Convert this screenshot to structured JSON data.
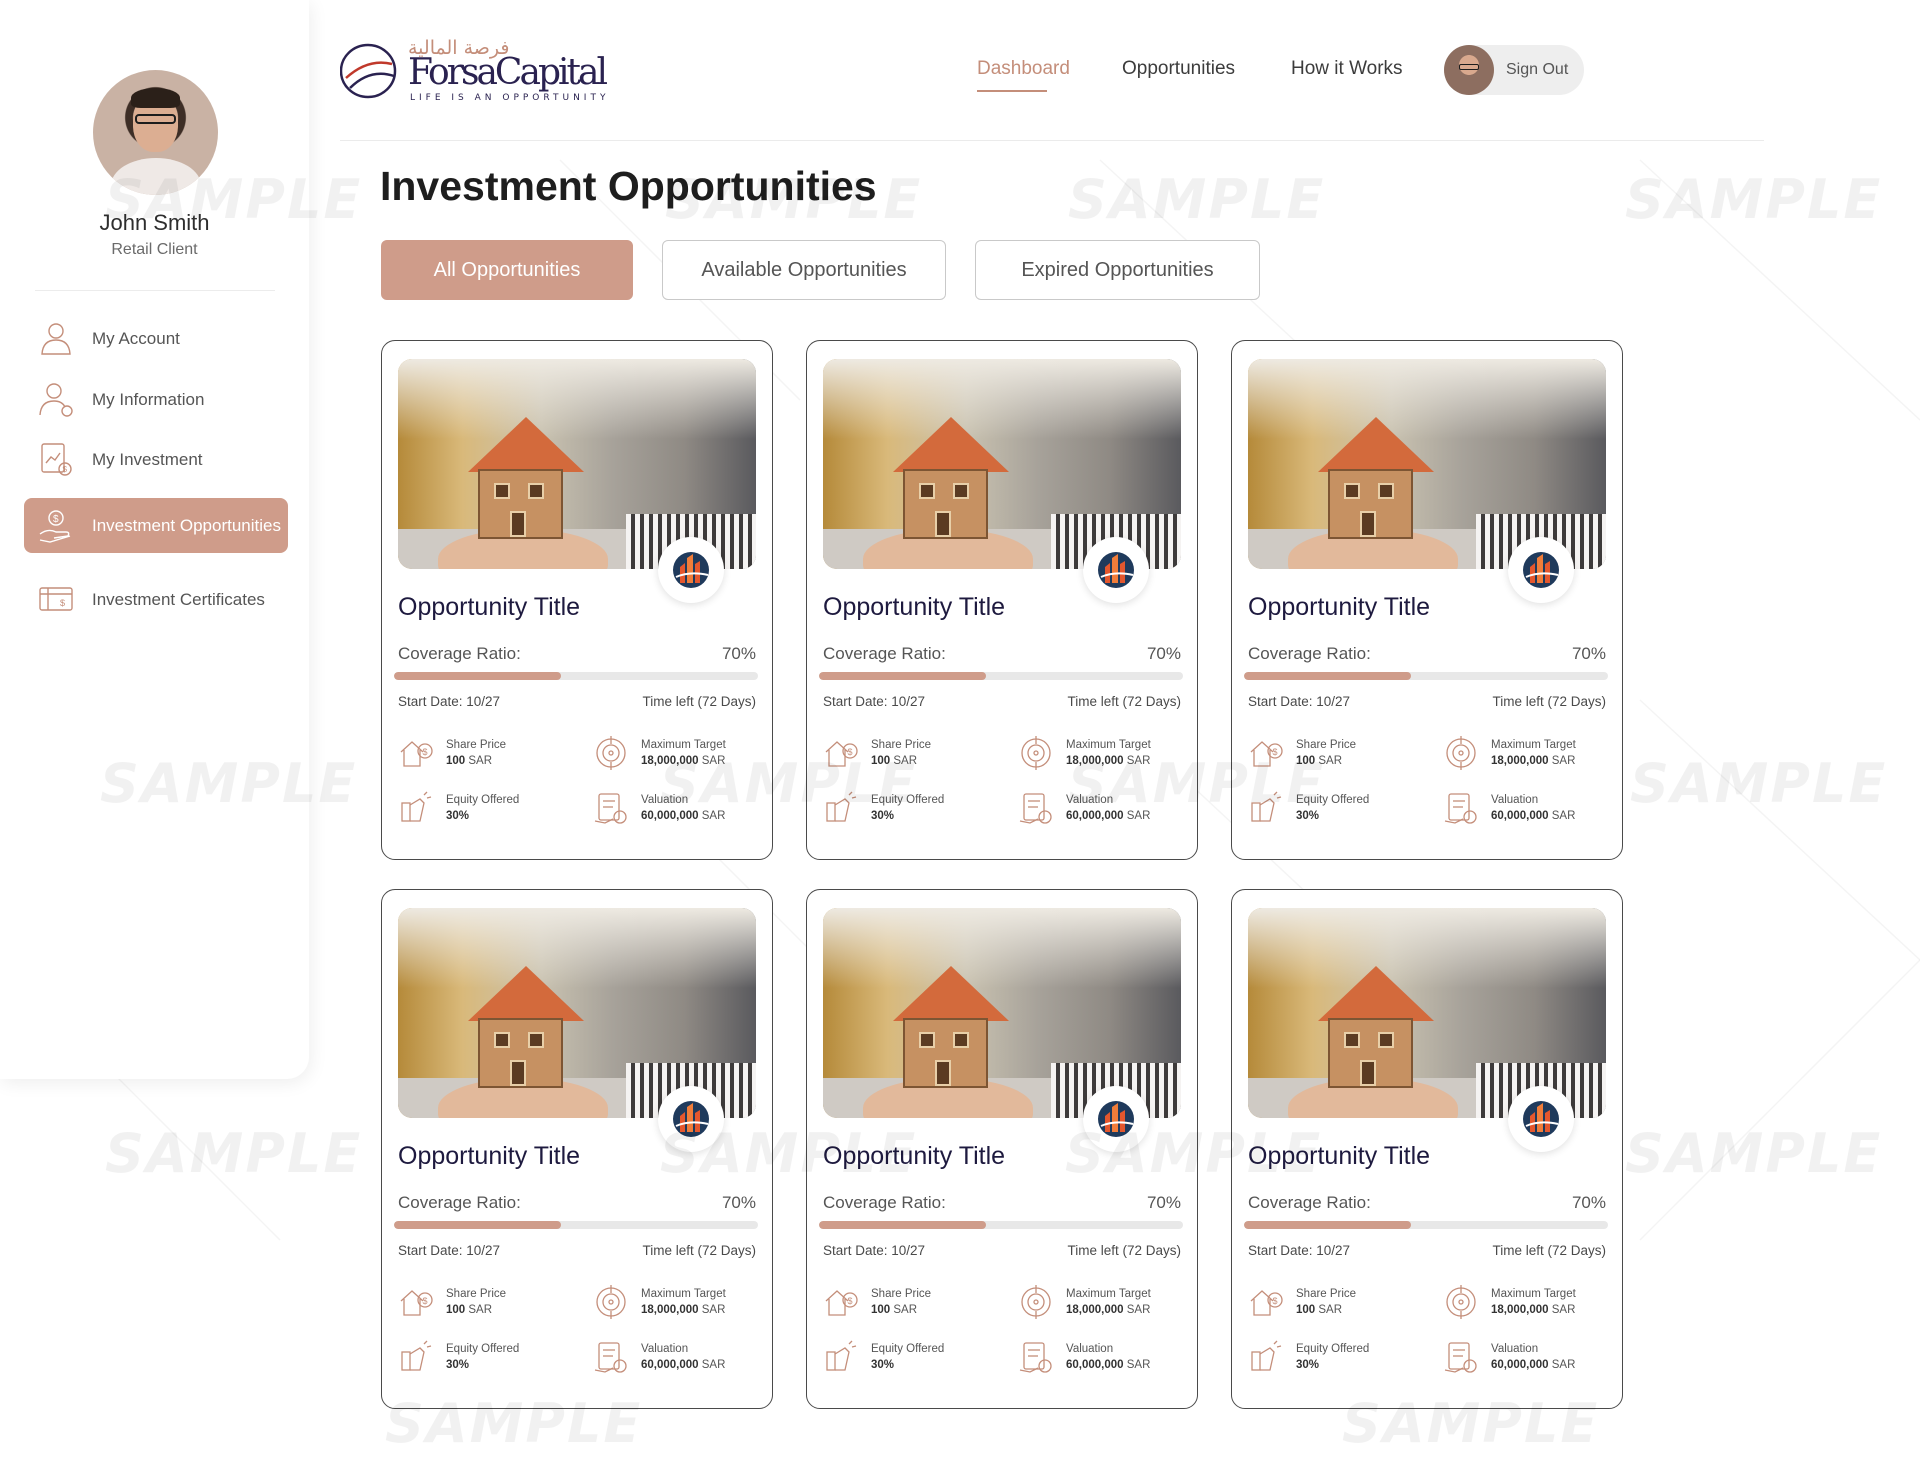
{
  "brand": {
    "logo_arabic": "فرصة المالية",
    "logo_name": "ForsaCapital",
    "tagline": "LIFE IS AN OPPORTUNITY"
  },
  "colors": {
    "accent": "#cf9c8a",
    "accent_text": "#c48e7a",
    "title_text": "#1e1a3f"
  },
  "user": {
    "name": "John Smith",
    "role": "Retail Client"
  },
  "sidebar": {
    "items": [
      {
        "label": "My Account",
        "icon": "user-icon"
      },
      {
        "label": "My Information",
        "icon": "user-info-icon"
      },
      {
        "label": "My Investment",
        "icon": "investment-doc-icon"
      },
      {
        "label": "Investment Opportunities",
        "icon": "hand-money-icon",
        "active": true
      },
      {
        "label": "Investment Certificates",
        "icon": "certificate-icon"
      }
    ]
  },
  "topnav": {
    "items": [
      {
        "label": "Dashboard",
        "active": true
      },
      {
        "label": "Opportunities"
      },
      {
        "label": "How it Works"
      }
    ],
    "signout_label": "Sign Out"
  },
  "page": {
    "title": "Investment Opportunities"
  },
  "tabs": [
    {
      "label": "All Opportunities",
      "active": true
    },
    {
      "label": "Available Opportunities"
    },
    {
      "label": "Expired Opportunities"
    }
  ],
  "watermark": "SAMPLE",
  "cards": [
    {
      "title": "Opportunity Title",
      "coverage_label": "Coverage Ratio:",
      "coverage_value": "70%",
      "progress_fraction": 0.46,
      "start_date": "Start Date: 10/27",
      "time_left": "Time left (72 Days)",
      "share_price_label": "Share Price",
      "share_price_value": "100",
      "share_price_unit": "SAR",
      "max_target_label": "Maximum Target",
      "max_target_value": "18,000,000",
      "max_target_unit": "SAR",
      "equity_label": "Equity Offered",
      "equity_value": "30%",
      "valuation_label": "Valuation",
      "valuation_value": "60,000,000",
      "valuation_unit": "SAR"
    },
    {
      "title": "Opportunity Title",
      "coverage_label": "Coverage Ratio:",
      "coverage_value": "70%",
      "progress_fraction": 0.46,
      "start_date": "Start Date: 10/27",
      "time_left": "Time left (72 Days)",
      "share_price_label": "Share Price",
      "share_price_value": "100",
      "share_price_unit": "SAR",
      "max_target_label": "Maximum Target",
      "max_target_value": "18,000,000",
      "max_target_unit": "SAR",
      "equity_label": "Equity Offered",
      "equity_value": "30%",
      "valuation_label": "Valuation",
      "valuation_value": "60,000,000",
      "valuation_unit": "SAR"
    },
    {
      "title": "Opportunity Title",
      "coverage_label": "Coverage Ratio:",
      "coverage_value": "70%",
      "progress_fraction": 0.46,
      "start_date": "Start Date: 10/27",
      "time_left": "Time left (72 Days)",
      "share_price_label": "Share Price",
      "share_price_value": "100",
      "share_price_unit": "SAR",
      "max_target_label": "Maximum Target",
      "max_target_value": "18,000,000",
      "max_target_unit": "SAR",
      "equity_label": "Equity Offered",
      "equity_value": "30%",
      "valuation_label": "Valuation",
      "valuation_value": "60,000,000",
      "valuation_unit": "SAR"
    },
    {
      "title": "Opportunity Title",
      "coverage_label": "Coverage Ratio:",
      "coverage_value": "70%",
      "progress_fraction": 0.46,
      "start_date": "Start Date: 10/27",
      "time_left": "Time left (72 Days)",
      "share_price_label": "Share Price",
      "share_price_value": "100",
      "share_price_unit": "SAR",
      "max_target_label": "Maximum Target",
      "max_target_value": "18,000,000",
      "max_target_unit": "SAR",
      "equity_label": "Equity Offered",
      "equity_value": "30%",
      "valuation_label": "Valuation",
      "valuation_value": "60,000,000",
      "valuation_unit": "SAR"
    },
    {
      "title": "Opportunity Title",
      "coverage_label": "Coverage Ratio:",
      "coverage_value": "70%",
      "progress_fraction": 0.46,
      "start_date": "Start Date: 10/27",
      "time_left": "Time left (72 Days)",
      "share_price_label": "Share Price",
      "share_price_value": "100",
      "share_price_unit": "SAR",
      "max_target_label": "Maximum Target",
      "max_target_value": "18,000,000",
      "max_target_unit": "SAR",
      "equity_label": "Equity Offered",
      "equity_value": "30%",
      "valuation_label": "Valuation",
      "valuation_value": "60,000,000",
      "valuation_unit": "SAR"
    },
    {
      "title": "Opportunity Title",
      "coverage_label": "Coverage Ratio:",
      "coverage_value": "70%",
      "progress_fraction": 0.46,
      "start_date": "Start Date: 10/27",
      "time_left": "Time left (72 Days)",
      "share_price_label": "Share Price",
      "share_price_value": "100",
      "share_price_unit": "SAR",
      "max_target_label": "Maximum Target",
      "max_target_value": "18,000,000",
      "max_target_unit": "SAR",
      "equity_label": "Equity Offered",
      "equity_value": "30%",
      "valuation_label": "Valuation",
      "valuation_value": "60,000,000",
      "valuation_unit": "SAR"
    }
  ]
}
